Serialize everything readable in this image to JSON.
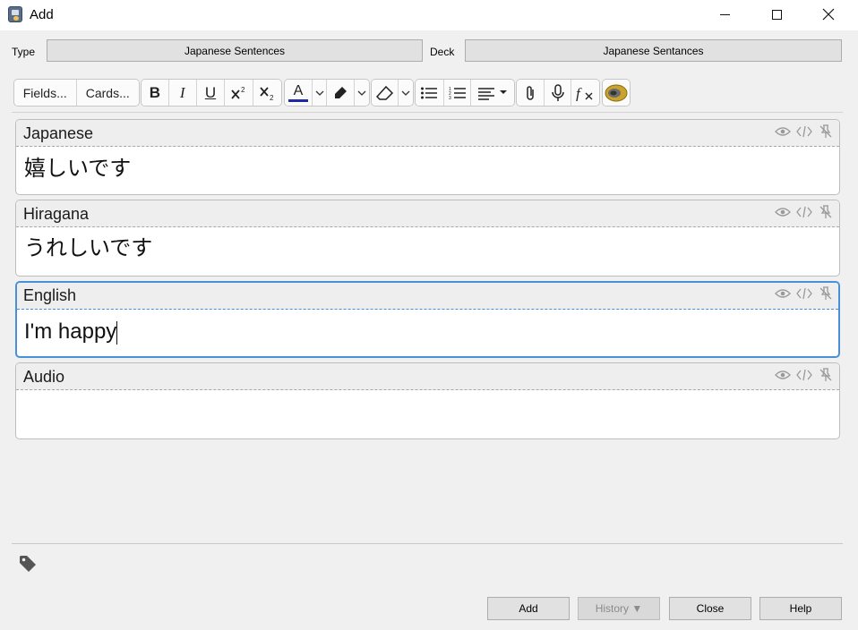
{
  "window": {
    "title": "Add"
  },
  "note_type": {
    "label": "Type",
    "value": "Japanese Sentences"
  },
  "deck": {
    "label": "Deck",
    "value": "Japanese Sentances"
  },
  "toolbar": {
    "fields_label": "Fields...",
    "cards_label": "Cards...",
    "bold": "B",
    "italic": "I",
    "underline": "U",
    "text_color_letter": "A",
    "text_color": "#1f28a6"
  },
  "fields": [
    {
      "name": "Japanese",
      "value": "嬉しいです"
    },
    {
      "name": "Hiragana",
      "value": "うれしいです"
    },
    {
      "name": "English",
      "value": "I'm happy"
    },
    {
      "name": "Audio",
      "value": ""
    }
  ],
  "buttons": {
    "add": "Add",
    "history": "History ▼",
    "close": "Close",
    "help": "Help"
  },
  "colors": {
    "focus": "#4a90d9"
  }
}
